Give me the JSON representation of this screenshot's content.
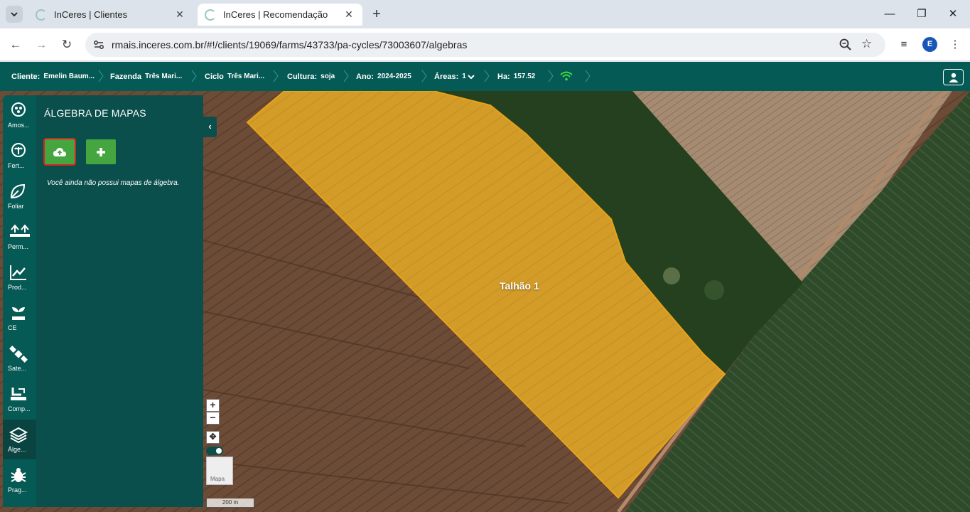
{
  "browser": {
    "tabs": [
      {
        "title": "InCeres | Clientes",
        "active": false
      },
      {
        "title": "InCeres | Recomendação",
        "active": true
      }
    ],
    "url": "rmais.inceres.com.br/#!/clients/19069/farms/43733/pa-cycles/73003607/algebras",
    "profile_initial": "E"
  },
  "header": {
    "cliente": {
      "label": "Cliente:",
      "value": "Emelin Baum..."
    },
    "fazenda": {
      "label": "Fazenda",
      "value": "Três Mari..."
    },
    "ciclo": {
      "label": "Ciclo",
      "value": "Três Mari..."
    },
    "cultura": {
      "label": "Cultura:",
      "value": "soja"
    },
    "ano": {
      "label": "Ano:",
      "value": "2024-2025"
    },
    "areas": {
      "label": "Áreas:",
      "value": "1"
    },
    "ha": {
      "label": "Ha:",
      "value": "157.52"
    },
    "colors": {
      "bar": "#065a55",
      "signal": "#3ddc3d"
    }
  },
  "sidenav": {
    "items": [
      {
        "label": "Amos...",
        "icon": "sampling-icon"
      },
      {
        "label": "Fert...",
        "icon": "fertility-icon"
      },
      {
        "label": "Foliar",
        "icon": "leaf-icon"
      },
      {
        "label": "Perm...",
        "icon": "permanent-crop-icon"
      },
      {
        "label": "Prod...",
        "icon": "productivity-chart-icon"
      },
      {
        "label": "CE",
        "icon": "seedling-icon"
      },
      {
        "label": "Sate...",
        "icon": "satellite-icon"
      },
      {
        "label": "Comp...",
        "icon": "compaction-icon"
      },
      {
        "label": "Álge...",
        "icon": "layers-icon",
        "active": true
      },
      {
        "label": "Prag...",
        "icon": "bug-icon"
      }
    ]
  },
  "panel": {
    "title": "ÁLGEBRA DE MAPAS",
    "empty_message": "Você ainda não possui mapas de álgebra.",
    "upload_icon": "cloud-upload-icon",
    "add_icon": "plus-icon"
  },
  "map": {
    "field_label": "Talhão 1",
    "zoom_in": "+",
    "zoom_out": "−",
    "basemap_label": "Mapa",
    "scale_label": "200 m",
    "field_color": "#e0a020"
  }
}
